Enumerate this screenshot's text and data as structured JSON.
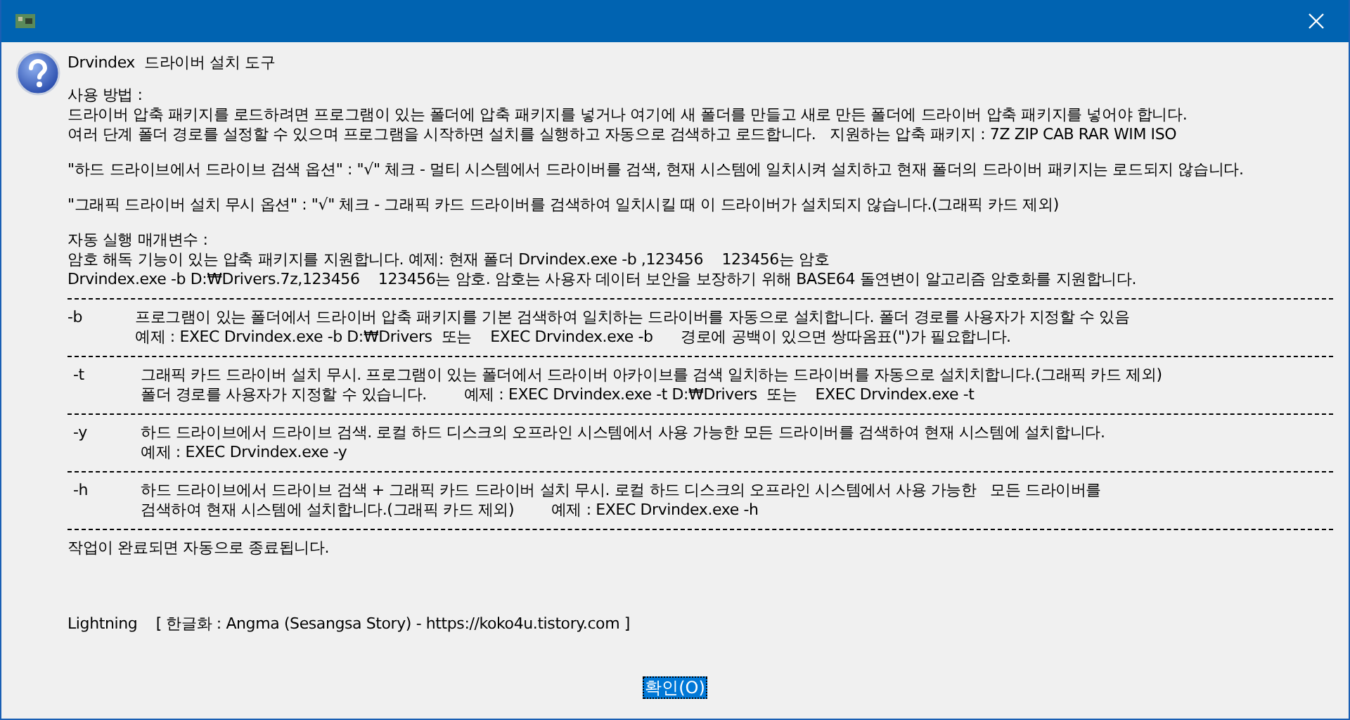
{
  "dialog": {
    "heading": "Drvindex  드라이버 설치 도구",
    "usage_title": "사용 방법 :",
    "usage_lines": [
      "드라이버 압축 패키지를 로드하려면 프로그램이 있는 폴더에 압축 패키지를 넣거나 여기에 새 폴더를 만들고 새로 만든 폴더에 드라이버 압축 패키지를 넣어야 합니다.",
      "여러 단계 폴더 경로를 설정할 수 있으며 프로그램을 시작하면 설치를 실행하고 자동으로 검색하고 로드합니다.   지원하는 압축 패키지 : 7Z ZIP CAB RAR WIM ISO"
    ],
    "option_notes": [
      "\"하드 드라이브에서 드라이브 검색 옵션\" : \"√\" 체크 - 멀티 시스템에서 드라이버를 검색, 현재 시스템에 일치시켜 설치하고 현재 폴더의 드라이버 패키지는 로드되지 않습니다.",
      "\"그래픽 드라이버 설치 무시 옵션\" : \"√\" 체크 - 그래픽 카드 드라이버를 검색하여 일치시킬 때 이 드라이버가 설치되지 않습니다.(그래픽 카드 제외)"
    ],
    "params_title": "자동 실행 매개변수 :",
    "params_lines": [
      "암호 해독 기능이 있는 압축 패키지를 지원합니다. 예제: 현재 폴더 Drvindex.exe -b ,123456    123456는 암호",
      "Drvindex.exe -b D:₩Drivers.7z,123456    123456는 암호. 암호는 사용자 데이터 보안을 보장하기 위해 BASE64 돌연변이 알고리즘 암호화를 지원합니다."
    ],
    "switches": [
      {
        "flag": "-b",
        "lines": [
          "프로그램이 있는 폴더에서 드라이버 압축 패키지를 기본 검색하여 일치하는 드라이버를 자동으로 설치합니다. 폴더 경로를 사용자가 지정할 수 있음",
          "예제 : EXEC Drvindex.exe -b D:₩Drivers  또는    EXEC Drvindex.exe -b      경로에 공백이 있으면 쌍따옴표(\")가 필요합니다."
        ]
      },
      {
        "flag": "-t",
        "lines": [
          "그래픽 카드 드라이버 설치 무시. 프로그램이 있는 폴더에서 드라이버 아카이브를 검색 일치하는 드라이버를 자동으로 설치치합니다.(그래픽 카드 제외)",
          "폴더 경로를 사용자가 지정할 수 있습니다.        예제 : EXEC Drvindex.exe -t D:₩Drivers  또는    EXEC Drvindex.exe -t"
        ]
      },
      {
        "flag": "-y",
        "lines": [
          "하드 드라이브에서 드라이브 검색. 로컬 하드 디스크의 오프라인 시스템에서 사용 가능한 모든 드라이버를 검색하여 현재 시스템에 설치합니다.",
          "예제 : EXEC Drvindex.exe -y"
        ]
      },
      {
        "flag": "-h",
        "lines": [
          "하드 드라이브에서 드라이브 검색 + 그래픽 카드 드라이버 설치 무시. 로컬 하드 디스크의 오프라인 시스템에서 사용 가능한   모든 드라이버를",
          "검색하여 현재 시스템에 설치합니다.(그래픽 카드 제외)        예제 : EXEC Drvindex.exe -h"
        ]
      }
    ],
    "closing": "작업이 완료되면 자동으로 종료됩니다.",
    "credits": "Lightning    [ 한글화 : Angma (Sesangsa Story) - https://koko4u.tistory.com ]"
  },
  "ok_button": {
    "label": "확인(O)",
    "focused": true
  }
}
